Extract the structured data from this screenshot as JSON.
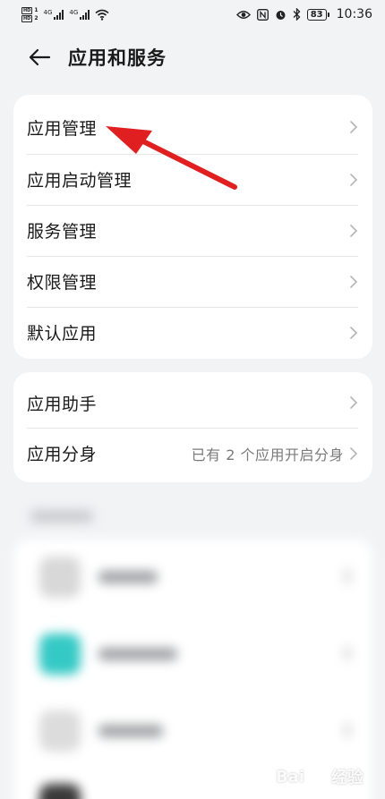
{
  "status_bar": {
    "sim1": "HD",
    "sim1_num": "1",
    "sim2": "HD",
    "sim2_num": "2",
    "net1": "4G",
    "net2": "4G",
    "battery": "83",
    "time": "10:36"
  },
  "header": {
    "title": "应用和服务"
  },
  "card1": {
    "items": [
      {
        "label": "应用管理"
      },
      {
        "label": "应用启动管理"
      },
      {
        "label": "服务管理"
      },
      {
        "label": "权限管理"
      },
      {
        "label": "默认应用"
      }
    ]
  },
  "card2": {
    "items": [
      {
        "label": "应用助手",
        "value": ""
      },
      {
        "label": "应用分身",
        "value": "已有 2 个应用开启分身"
      }
    ]
  },
  "colors": {
    "background": "#f1f3f5",
    "card": "#ffffff",
    "arrow": "#e02020",
    "teal_icon": "#35c9c5"
  },
  "watermark": {
    "text": "Bai",
    "text2": "经验"
  }
}
